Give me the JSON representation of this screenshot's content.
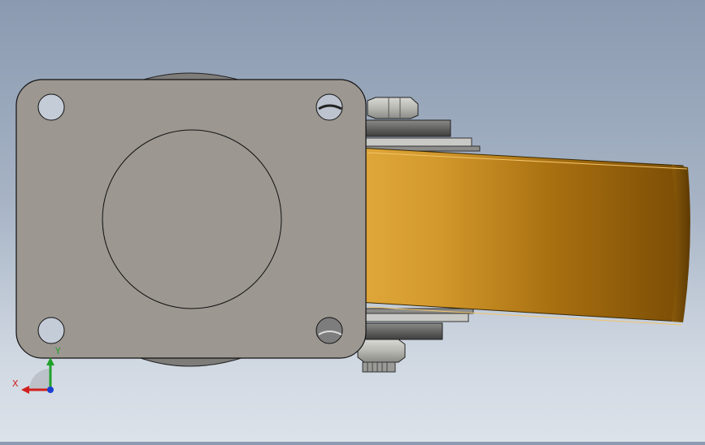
{
  "viewport": {
    "background_top": "#8b9ab0",
    "background_bottom": "#dce2ea"
  },
  "model": {
    "plate_color": "#9c9791",
    "wheel_color": "#d49a2e",
    "hardware_color": "#6e6e6e"
  },
  "triad": {
    "x_label": "X",
    "y_label": "Y",
    "x_color": "#d0201e",
    "y_color": "#1fa12a",
    "z_color": "#1a3fd0"
  }
}
